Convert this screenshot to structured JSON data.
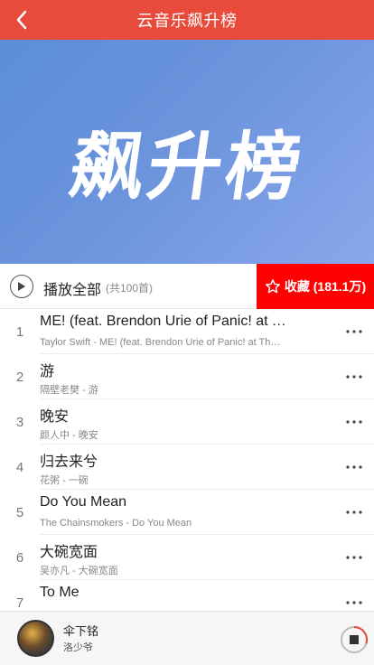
{
  "header": {
    "title": "云音乐飙升榜"
  },
  "banner": {
    "text": "飙升榜"
  },
  "playbar": {
    "play_all_label": "播放全部",
    "count_label": "(共100首)",
    "collect_label": "收藏 (181.1万)"
  },
  "songs": [
    {
      "index": "1",
      "title": "ME! (feat. Brendon Urie of Panic! at The Disco)",
      "subtitle": "Taylor Swift - ME! (feat. Brendon Urie of Panic! at The Disco)"
    },
    {
      "index": "2",
      "title": "游",
      "subtitle": "隔壁老樊 - 游"
    },
    {
      "index": "3",
      "title": "晚安",
      "subtitle": "颜人中 - 晚安"
    },
    {
      "index": "4",
      "title": "归去来兮",
      "subtitle": "花粥 - 一碗"
    },
    {
      "index": "5",
      "title": "Do You Mean",
      "subtitle": "The Chainsmokers - Do You Mean"
    },
    {
      "index": "6",
      "title": "大碗宽面",
      "subtitle": "吴亦凡 - 大碗宽面"
    },
    {
      "index": "7",
      "title": "To Me",
      "subtitle": ""
    }
  ],
  "player": {
    "title": "伞下铭",
    "artist": "洛少爷",
    "progress": 0.3
  },
  "colors": {
    "header": "#e84b3c",
    "collect": "#fe0101",
    "accent": "#e84b3c"
  },
  "icons": {
    "back": "chevron-left-icon",
    "play": "play-icon",
    "star": "star-icon",
    "more": "more-dots-icon",
    "stop": "stop-icon"
  }
}
